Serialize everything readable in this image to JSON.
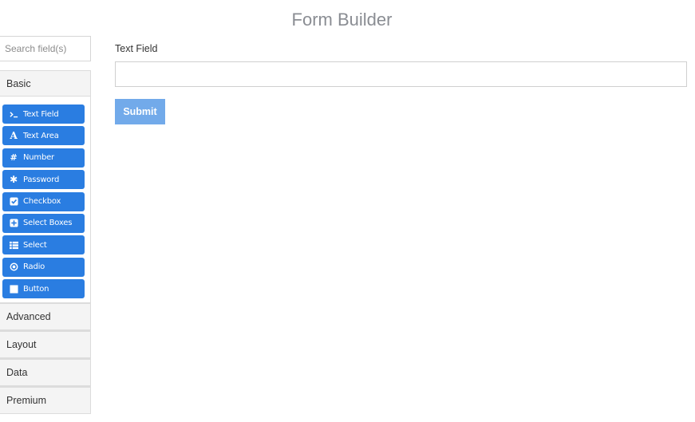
{
  "header": {
    "title": "Form Builder"
  },
  "sidebar": {
    "search_placeholder": "Search field(s)",
    "groups": [
      {
        "label": "Basic",
        "expanded": true,
        "items": [
          {
            "label": "Text Field",
            "icon": "terminal-icon"
          },
          {
            "label": "Text Area",
            "icon": "font-icon"
          },
          {
            "label": "Number",
            "icon": "hashtag-icon"
          },
          {
            "label": "Password",
            "icon": "asterisk-icon"
          },
          {
            "label": "Checkbox",
            "icon": "check-square-icon"
          },
          {
            "label": "Select Boxes",
            "icon": "plus-square-icon"
          },
          {
            "label": "Select",
            "icon": "list-icon"
          },
          {
            "label": "Radio",
            "icon": "dot-circle-icon"
          },
          {
            "label": "Button",
            "icon": "stop-icon"
          }
        ]
      },
      {
        "label": "Advanced",
        "expanded": false
      },
      {
        "label": "Layout",
        "expanded": false
      },
      {
        "label": "Data",
        "expanded": false
      },
      {
        "label": "Premium",
        "expanded": false
      }
    ]
  },
  "form": {
    "field_label": "Text Field",
    "field_value": "",
    "submit_label": "Submit"
  },
  "colors": {
    "primary": "#2a7de1",
    "submit_disabled": "#72aaea",
    "title": "#8a8d93"
  }
}
